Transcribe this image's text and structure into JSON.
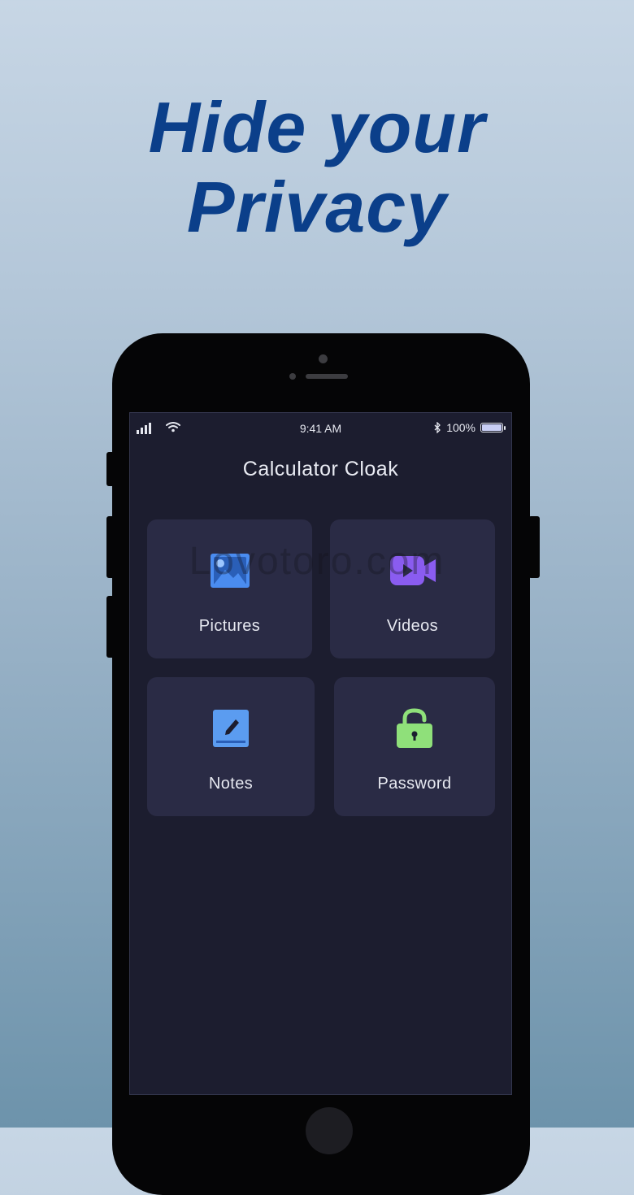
{
  "headline": {
    "line1": "Hide your",
    "line2": "Privacy"
  },
  "status_bar": {
    "time": "9:41 AM",
    "battery": "100%"
  },
  "app": {
    "title": "Calculator Cloak"
  },
  "tiles": [
    {
      "label": "Pictures",
      "icon": "pictures-icon",
      "color": "#4a8cf0"
    },
    {
      "label": "Videos",
      "icon": "videos-icon",
      "color": "#8a5cf0"
    },
    {
      "label": "Notes",
      "icon": "notes-icon",
      "color": "#5b9cf0"
    },
    {
      "label": "Password",
      "icon": "lock-icon",
      "color": "#8fe07a"
    }
  ],
  "colors": {
    "headline": "#0b3f8a",
    "screen_bg": "#1c1d2f",
    "tile_bg": "#2a2b45"
  },
  "watermark": "Lovotoro.com"
}
